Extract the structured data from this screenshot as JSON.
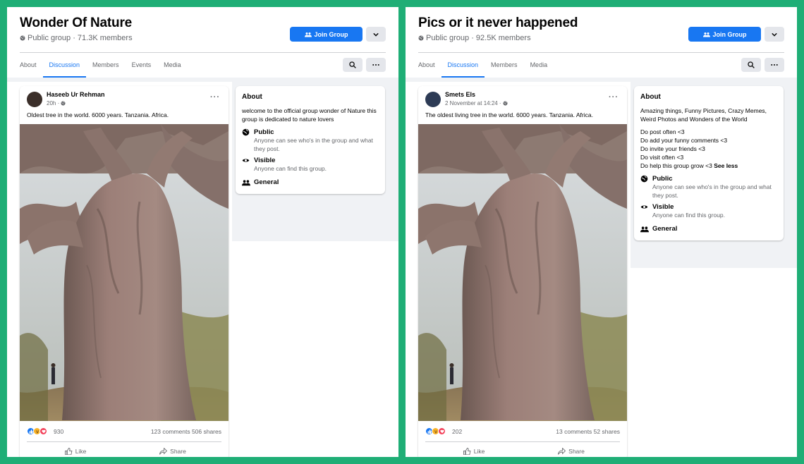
{
  "colors": {
    "frame": "#1fae76",
    "accent": "#1877f2",
    "muted": "#65676b"
  },
  "panels": [
    {
      "group": {
        "title": "Wonder Of Nature",
        "meta": "Public group · 71.3K members",
        "join_label": "Join Group"
      },
      "tabs": [
        "About",
        "Discussion",
        "Members",
        "Events",
        "Media"
      ],
      "active_tab": "Discussion",
      "post": {
        "author": "Haseeb Ur Rehman",
        "time": "20h ·",
        "text": "Oldest tree in the world. 6000 years. Tanzania. Africa.",
        "reaction_count": "930",
        "stats": "123 comments  506 shares",
        "like_label": "Like",
        "share_label": "Share"
      },
      "about": {
        "title": "About",
        "description": "welcome to the official group wonder of Nature this group is dedicated to nature lovers",
        "rules": [],
        "see_less": "",
        "public_label": "Public",
        "public_desc": "Anyone can see who's in the group and what they post.",
        "visible_label": "Visible",
        "visible_desc": "Anyone can find this group.",
        "general_label": "General"
      }
    },
    {
      "group": {
        "title": "Pics or it never happened",
        "meta": "Public group · 92.5K members",
        "join_label": "Join Group"
      },
      "tabs": [
        "About",
        "Discussion",
        "Members",
        "Media"
      ],
      "active_tab": "Discussion",
      "post": {
        "author": "Smets Els",
        "time": "2 November at 14:24 ·",
        "text": "The oldest living tree in the world. 6000 years. Tanzania. Africa.",
        "reaction_count": "202",
        "stats": "13 comments  52 shares",
        "like_label": "Like",
        "share_label": "Share"
      },
      "about": {
        "title": "About",
        "description": "Amazing things, Funny Pictures, Crazy Memes, Weird Photos and Wonders of the World",
        "rules": [
          "Do post often <3",
          "Do add your funny comments <3",
          "Do invite your friends <3",
          "Do visit often <3",
          "Do help this group grow <3"
        ],
        "see_less": "See less",
        "public_label": "Public",
        "public_desc": "Anyone can see who's in the group and what they post.",
        "visible_label": "Visible",
        "visible_desc": "Anyone can find this group.",
        "general_label": "General"
      }
    }
  ]
}
